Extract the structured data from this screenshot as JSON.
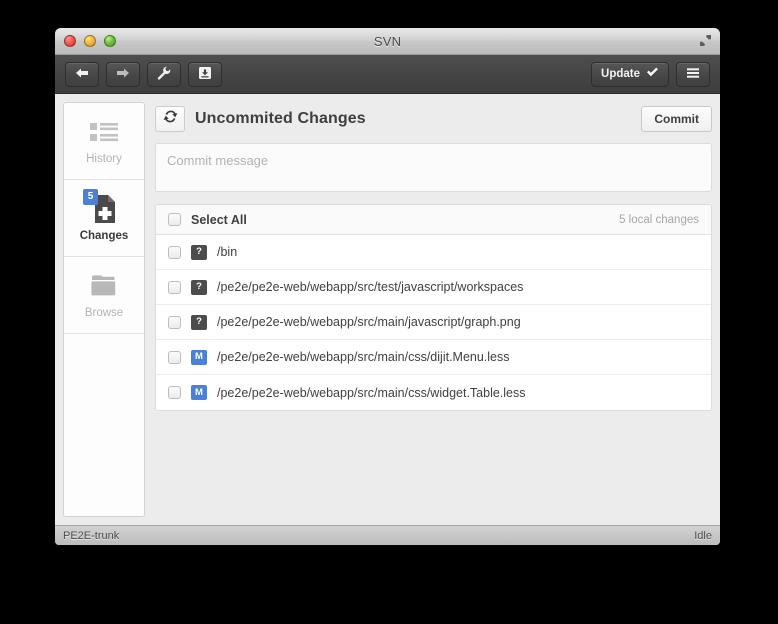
{
  "window": {
    "title": "SVN",
    "expand_icon": "expand-arrows-icon",
    "lights": [
      "close-light",
      "minimize-light",
      "zoom-light"
    ]
  },
  "toolbar": {
    "back_icon": "arrow-left-icon",
    "forward_icon": "arrow-right-icon",
    "settings_icon": "wrench-icon",
    "inbox_icon": "inbox-tray-icon",
    "update_label": "Update",
    "update_check_icon": "checkmark-icon",
    "menu_icon": "hamburger-menu-icon"
  },
  "sidebar": {
    "items": [
      {
        "label": "History",
        "icon": "list-view-icon",
        "badge": "",
        "active": false
      },
      {
        "label": "Changes",
        "icon": "file-plus-icon",
        "badge": "5",
        "active": true
      },
      {
        "label": "Browse",
        "icon": "folder-icon",
        "badge": "",
        "active": false
      }
    ]
  },
  "main": {
    "refresh_icon": "refresh-icon",
    "title": "Uncommited Changes",
    "commit_label": "Commit",
    "commit_message_value": "",
    "commit_message_placeholder": "Commit message",
    "select_all_label": "Select All",
    "local_changes_label": "5 local changes",
    "files": [
      {
        "status": "?",
        "status_color": "#4c4c4c",
        "path": "/bin",
        "checked": false
      },
      {
        "status": "?",
        "status_color": "#4c4c4c",
        "path": "/pe2e/pe2e-web/webapp/src/test/javascript/workspaces",
        "checked": false
      },
      {
        "status": "?",
        "status_color": "#4c4c4c",
        "path": "/pe2e/pe2e-web/webapp/src/main/javascript/graph.png",
        "checked": false
      },
      {
        "status": "M",
        "status_color": "#4a80d8",
        "path": "/pe2e/pe2e-web/webapp/src/main/css/dijit.Menu.less",
        "checked": false
      },
      {
        "status": "M",
        "status_color": "#4a80d8",
        "path": "/pe2e/pe2e-web/webapp/src/main/css/widget.Table.less",
        "checked": false
      }
    ]
  },
  "statusbar": {
    "repository": "PE2E-trunk",
    "state": "Idle"
  }
}
